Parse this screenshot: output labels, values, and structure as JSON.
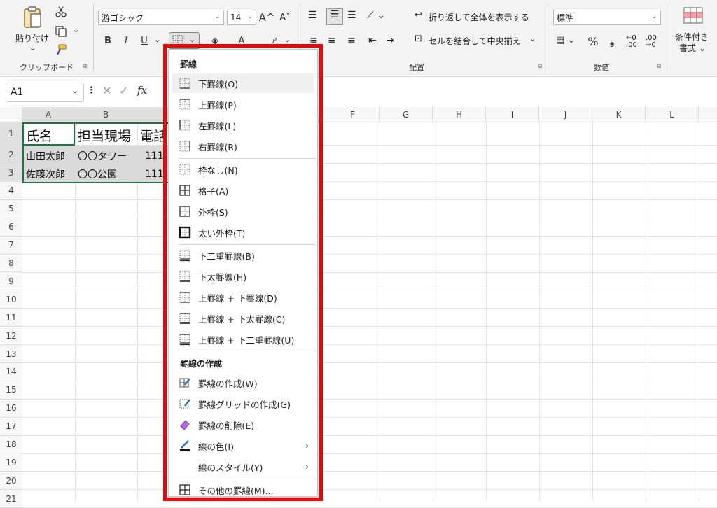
{
  "ribbon": {
    "clipboard": {
      "paste_label": "貼り付け",
      "paste_arrow": "⌄",
      "group_label": "クリップボード"
    },
    "font": {
      "name": "游ゴシック",
      "size": "14",
      "grow_label": "A^",
      "shrink_label": "A˅",
      "bold": "B",
      "italic": "I",
      "underline": "U",
      "font_color_label": "A",
      "phonetic_label": "ア"
    },
    "alignment": {
      "wrap_label": "折り返して全体を表示する",
      "merge_label": "セルを結合して中央揃え",
      "group_label": "配置"
    },
    "number": {
      "format": "標準",
      "percent": "%",
      "comma": "❟",
      "group_label": "数値"
    },
    "styles": {
      "conditional_label_1": "条件付き",
      "conditional_label_2": "書式 ⌄"
    }
  },
  "formula_bar": {
    "name_box": "A1",
    "fx": "fx"
  },
  "columns": [
    "A",
    "B",
    "F",
    "G",
    "H",
    "I",
    "J",
    "K",
    "L"
  ],
  "rows": [
    "1",
    "2",
    "3",
    "4",
    "5",
    "6",
    "7",
    "8",
    "9",
    "10",
    "11",
    "12",
    "13",
    "14",
    "15",
    "16",
    "17",
    "18",
    "19",
    "20",
    "21"
  ],
  "cells": {
    "a1": "氏名",
    "b1": "担当現場",
    "c1": "電話",
    "a2": "山田太郎",
    "b2": "〇〇タワー",
    "c2": "111",
    "a3": "佐藤次郎",
    "b3": "〇〇公園",
    "c3": "111"
  },
  "border_menu": {
    "section1_header": "罫線",
    "items1": [
      {
        "label": "下罫線(O)",
        "icon": "bottom-border-icon"
      },
      {
        "label": "上罫線(P)",
        "icon": "top-border-icon"
      },
      {
        "label": "左罫線(L)",
        "icon": "left-border-icon"
      },
      {
        "label": "右罫線(R)",
        "icon": "right-border-icon"
      },
      {
        "label": "枠なし(N)",
        "icon": "no-border-icon"
      },
      {
        "label": "格子(A)",
        "icon": "all-borders-icon"
      },
      {
        "label": "外枠(S)",
        "icon": "outside-borders-icon"
      },
      {
        "label": "太い外枠(T)",
        "icon": "thick-outside-border-icon"
      },
      {
        "label": "下二重罫線(B)",
        "icon": "bottom-double-border-icon"
      },
      {
        "label": "下太罫線(H)",
        "icon": "thick-bottom-border-icon"
      },
      {
        "label": "上罫線 + 下罫線(D)",
        "icon": "top-bottom-border-icon"
      },
      {
        "label": "上罫線 + 下太罫線(C)",
        "icon": "top-thick-bottom-border-icon"
      },
      {
        "label": "上罫線 + 下二重罫線(U)",
        "icon": "top-double-bottom-border-icon"
      }
    ],
    "section2_header": "罫線の作成",
    "items2": [
      {
        "label": "罫線の作成(W)",
        "icon": "draw-border-icon"
      },
      {
        "label": "罫線グリッドの作成(G)",
        "icon": "draw-border-grid-icon"
      },
      {
        "label": "罫線の削除(E)",
        "icon": "eraser-icon"
      },
      {
        "label": "線の色(I)",
        "icon": "line-color-icon",
        "submenu": "›"
      },
      {
        "label": "線のスタイル(Y)",
        "icon": "",
        "submenu": "›"
      },
      {
        "label": "その他の罫線(M)...",
        "icon": "more-borders-icon"
      }
    ]
  },
  "colors": {
    "highlight_box": "#e8080a",
    "selection": "#217346"
  }
}
